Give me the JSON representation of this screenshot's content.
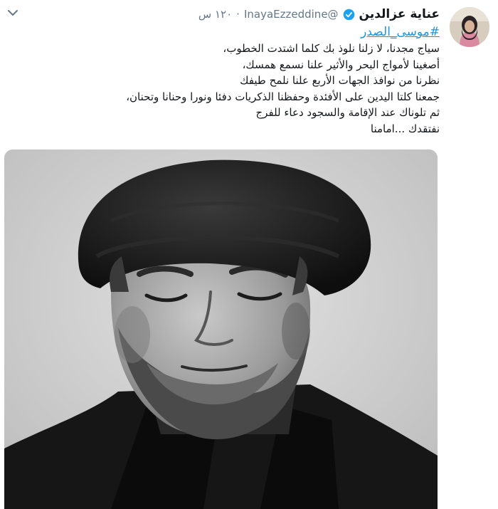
{
  "user": {
    "display_name": "عناية عزالدين",
    "handle": "@InayaEzzeddine",
    "dot": "·",
    "time": "١٢٠ س"
  },
  "tweet": {
    "hashtag": "#موسى_الصدر",
    "lines": [
      "سياج مجدنا، لا زلنا نلوذ بك كلما اشتدت الخطوب،",
      "أصغينا لأمواج البحر والأثير علنا نسمع همسك،",
      "نظرنا من نوافذ الجهات الأربع علنا نلمح طيفك",
      "جمعنا كلتا اليدين على الأفئدة وحفظنا الذكريات دفئا ونورا وحنانا وتحنان،",
      "ثم تلوناك عند الإقامة والسجود دعاء للفرج",
      "نفتقدك ...امامنا"
    ]
  },
  "icons": {
    "caret": "chevron-down-icon",
    "verified": "verified-badge-icon"
  },
  "colors": {
    "link": "#1b95e0",
    "verified": "#1da1f2",
    "secondary_text": "#657786"
  }
}
